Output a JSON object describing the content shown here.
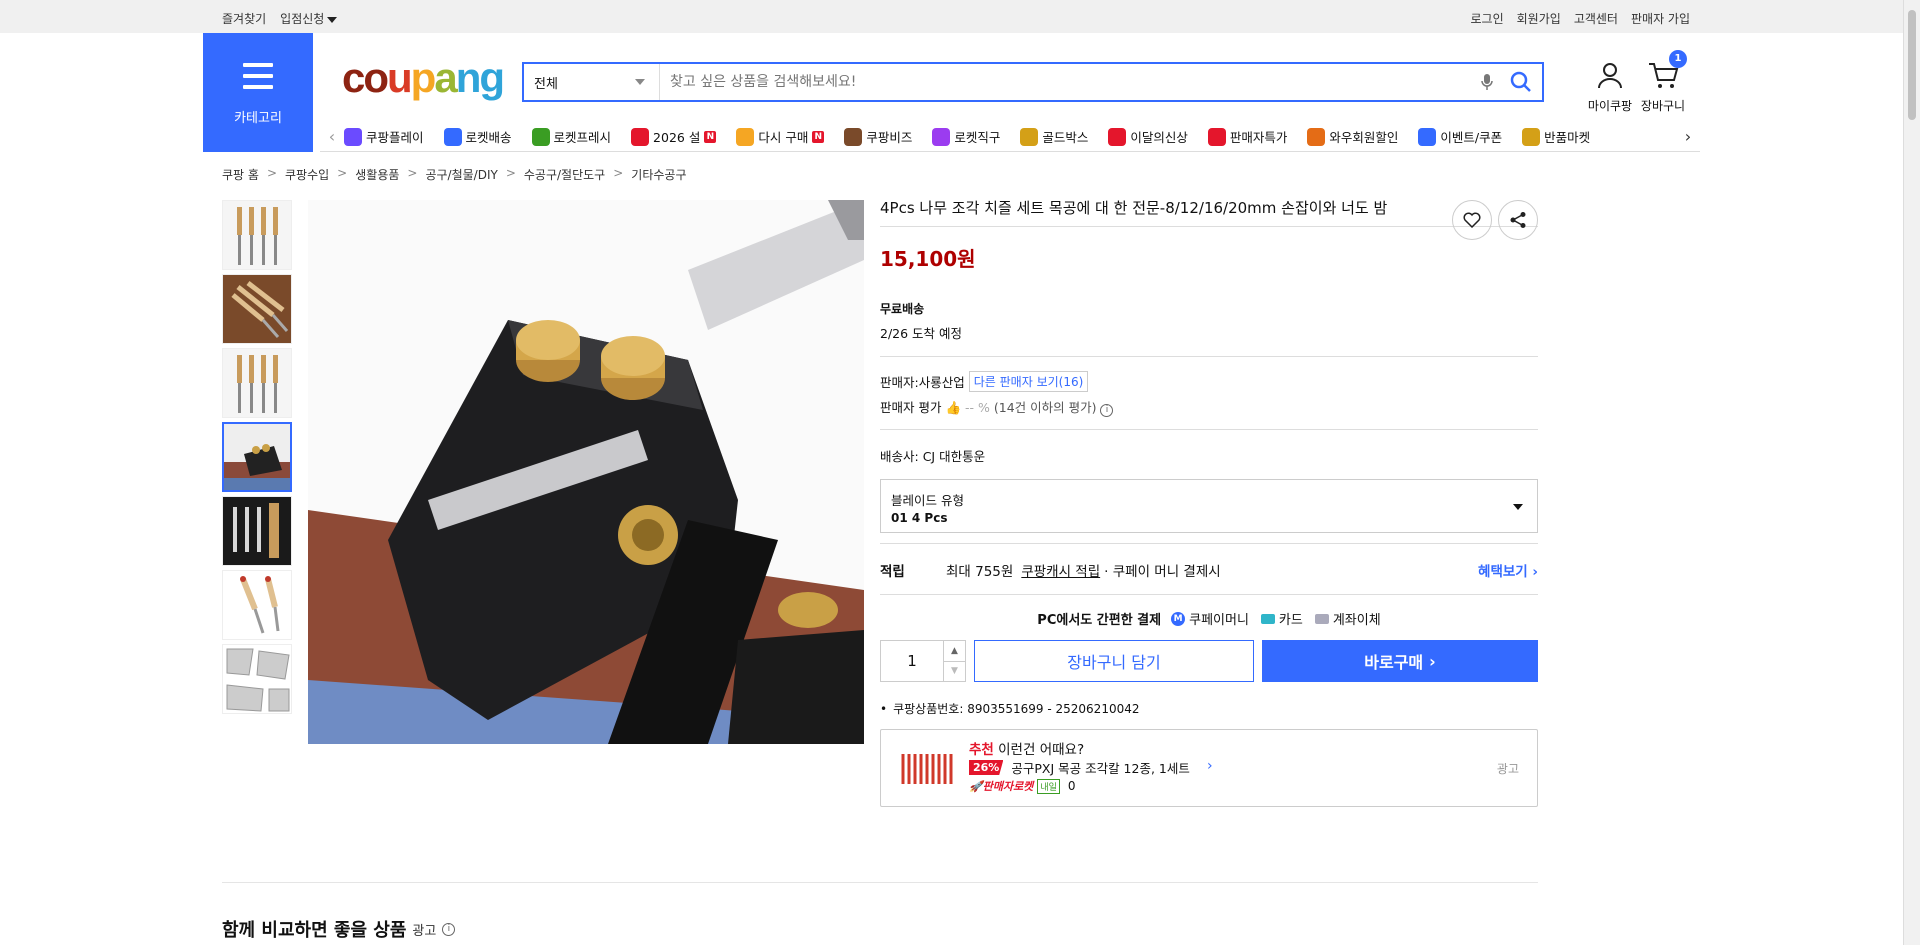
{
  "topbar": {
    "left": [
      "즐겨찾기",
      "입점신청"
    ],
    "right": [
      "로그인",
      "회원가입",
      "고객센터",
      "판매자 가입"
    ]
  },
  "header": {
    "category_label": "카테고리",
    "logo": "coupang",
    "search": {
      "select_value": "전체",
      "placeholder": "찾고 싶은 상품을 검색해보세요!"
    },
    "my_coupang": "마이쿠팡",
    "cart_label": "장바구니",
    "cart_count": "1"
  },
  "nav": [
    {
      "label": "쿠팡플레이",
      "color": "#6b4bff",
      "new": false
    },
    {
      "label": "로켓배송",
      "color": "#346aff",
      "new": false
    },
    {
      "label": "로켓프레시",
      "color": "#3a9d23",
      "new": false
    },
    {
      "label": "2026 설",
      "color": "#e4162c",
      "new": true
    },
    {
      "label": "다시 구매",
      "color": "#f5a623",
      "new": true
    },
    {
      "label": "쿠팡비즈",
      "color": "#7a4a2a",
      "new": false
    },
    {
      "label": "로켓직구",
      "color": "#9b3cf0",
      "new": false
    },
    {
      "label": "골드박스",
      "color": "#d4a017",
      "new": false
    },
    {
      "label": "이달의신상",
      "color": "#e4162c",
      "new": false
    },
    {
      "label": "판매자특가",
      "color": "#e4162c",
      "new": false
    },
    {
      "label": "와우회원할인",
      "color": "#e46c16",
      "new": false
    },
    {
      "label": "이벤트/쿠폰",
      "color": "#346aff",
      "new": false
    },
    {
      "label": "반품마켓",
      "color": "#d4a017",
      "new": false
    }
  ],
  "breadcrumb": [
    "쿠팡 홈",
    "쿠팡수입",
    "생활용품",
    "공구/철물/DIY",
    "수공구/절단도구",
    "기타수공구"
  ],
  "product": {
    "title": "4Pcs 나무 조각 치즐 세트 목공에 대 한 전문-8/12/16/20mm 손잡이와 너도 밤",
    "price": "15,100원",
    "shipping_title": "무료배송",
    "shipping_date": "2/26 도착 예정",
    "seller_label": "판매자:",
    "seller_name": "사룡산업",
    "other_sellers": "다른 판매자 보기(16)",
    "rating_label": "판매자 평가",
    "rating_value": "-- %",
    "rating_note": "(14건 이하의 평가)",
    "carrier_label": "배송사:",
    "carrier_name": "CJ 대한통운",
    "option_label": "블레이드 유형",
    "option_value": "01 4 Pcs",
    "reward_label": "적립",
    "reward_max": "최대 755원",
    "reward_cash": "쿠팡캐시 적립",
    "reward_suffix": "· 쿠페이 머니 결제시",
    "reward_more": "혜택보기",
    "pc_pay": "PC에서도 간편한 결제",
    "pay_methods": [
      "쿠페이머니",
      "카드",
      "계좌이체"
    ],
    "qty": "1",
    "cart_button": "장바구니 담기",
    "buy_button": "바로구매",
    "product_id_label": "쿠팡상품번호:",
    "product_id": "8903551699 - 25206210042"
  },
  "recommend": {
    "tag": "추천",
    "title": "이런건 어때요?",
    "discount": "26%",
    "name": "공구PXJ 목공 조각칼 12종, 1세트",
    "rocket": "판매자로켓",
    "next_day": "내일",
    "reviews": "0",
    "ad": "광고"
  },
  "compare": {
    "title": "함께 비교하면 좋을 상품",
    "ad": "광고"
  }
}
